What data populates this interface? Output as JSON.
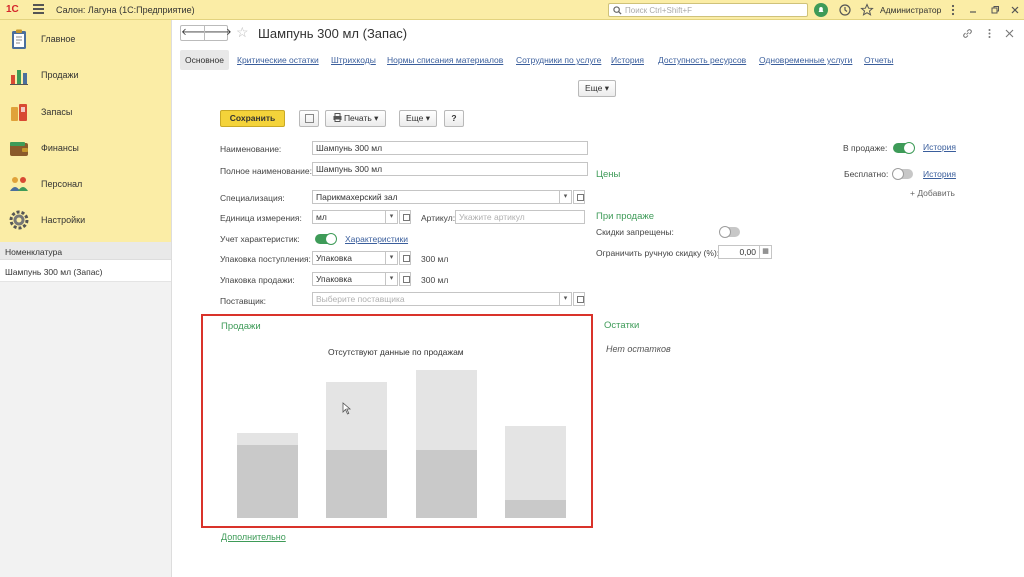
{
  "topbar": {
    "logo": "1С",
    "app_title": "Салон: Лагуна  (1С:Предприятие)",
    "search_placeholder": "Поиск Ctrl+Shift+F",
    "user": "Администратор"
  },
  "sidebar": {
    "sections": [
      {
        "label": "Главное",
        "icon": "clipboard-icon"
      },
      {
        "label": "Продажи",
        "icon": "bar-chart-icon"
      },
      {
        "label": "Запасы",
        "icon": "products-icon"
      },
      {
        "label": "Финансы",
        "icon": "wallet-icon"
      },
      {
        "label": "Персонал",
        "icon": "people-icon"
      },
      {
        "label": "Настройки",
        "icon": "gear-icon"
      }
    ],
    "nav_title": "Номенклатура",
    "open_item": "Шампунь 300 мл (Запас)"
  },
  "header": {
    "title": "Шампунь 300 мл (Запас)"
  },
  "tabs": [
    "Основное",
    "Критические остатки",
    "Штрихкоды",
    "Нормы списания материалов",
    "Сотрудники по услуге",
    "История",
    "Доступность ресурсов",
    "Одновременные услуги",
    "Отчеты"
  ],
  "more_button": "Еще",
  "toolbar": {
    "save": "Сохранить",
    "print": "Печать",
    "more": "Еще",
    "help": "?"
  },
  "form": {
    "name_label": "Наименование:",
    "name_value": "Шампунь 300 мл",
    "fullname_label": "Полное наименование:",
    "fullname_value": "Шампунь 300 мл",
    "spec_label": "Специализация:",
    "spec_value": "Парикмахерский зал",
    "unit_label": "Единица измерения:",
    "unit_value": "мл",
    "article_label": "Артикул:",
    "article_placeholder": "Укажите артикул",
    "char_label": "Учет характеристик:",
    "char_link": "Характеристики",
    "pack_in_label": "Упаковка поступления:",
    "pack_in_value": "Упаковка",
    "pack_in_qty": "300 мл",
    "pack_out_label": "Упаковка продажи:",
    "pack_out_value": "Упаковка",
    "pack_out_qty": "300 мл",
    "supplier_label": "Поставщик:",
    "supplier_placeholder": "Выберите поставщика"
  },
  "right": {
    "prices_title": "Цены",
    "on_sale_label": "В продаже:",
    "history_link": "История",
    "free_label": "Бесплатно:",
    "history_link2": "История",
    "add_link": "+ Добавить",
    "sale_title": "При продаже",
    "discounts_label": "Скидки запрещены:",
    "limit_label": "Ограничить ручную скидку (%):",
    "limit_value": "0,00"
  },
  "sales": {
    "title": "Продажи",
    "empty_message": "Отсутствуют данные по продажам"
  },
  "stock": {
    "title": "Остатки",
    "empty_message": "Нет остатков"
  },
  "more_link": "Дополнительно",
  "colors": {
    "accent_yellow": "#fbeda6",
    "save_button": "#f4d33a",
    "green": "#3e9b58",
    "highlight_red": "#d9322a"
  }
}
